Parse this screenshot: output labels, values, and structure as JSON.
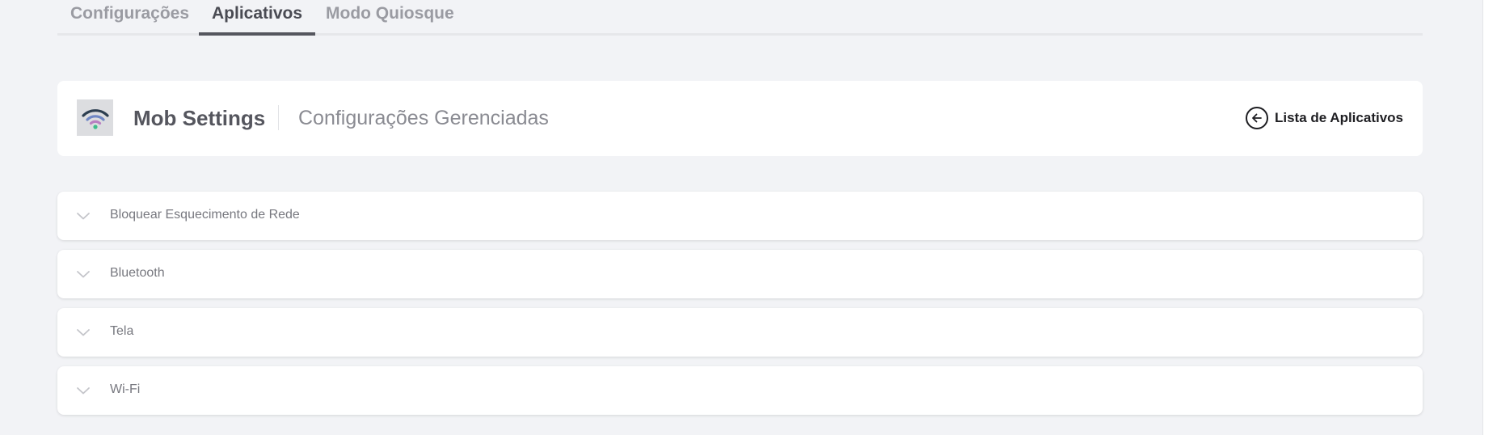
{
  "tabs": [
    {
      "label": "Configurações",
      "active": false
    },
    {
      "label": "Aplicativos",
      "active": true
    },
    {
      "label": "Modo Quiosque",
      "active": false
    }
  ],
  "header": {
    "app_name": "Mob Settings",
    "subtitle": "Configurações Gerenciadas",
    "app_icon": "wifi-icon",
    "back_link_icon": "arrow-left-circle-icon",
    "back_link_label": "Lista de Aplicativos"
  },
  "accordion": [
    {
      "title": "Bloquear Esquecimento de Rede",
      "expanded": false
    },
    {
      "title": "Bluetooth",
      "expanded": false
    },
    {
      "title": "Tela",
      "expanded": false
    },
    {
      "title": "Wi-Fi",
      "expanded": false
    }
  ],
  "colors": {
    "page_background": "#f2f3f6",
    "card_background": "#ffffff",
    "active_tab_text": "#4a4b53",
    "inactive_tab_text": "#9a9ba2",
    "wifi_arc_outer": "#2c3e50",
    "wifi_arc_middle": "#6f87c5",
    "wifi_arc_inner": "#b97fc2",
    "wifi_dot": "#3ebd8b"
  }
}
